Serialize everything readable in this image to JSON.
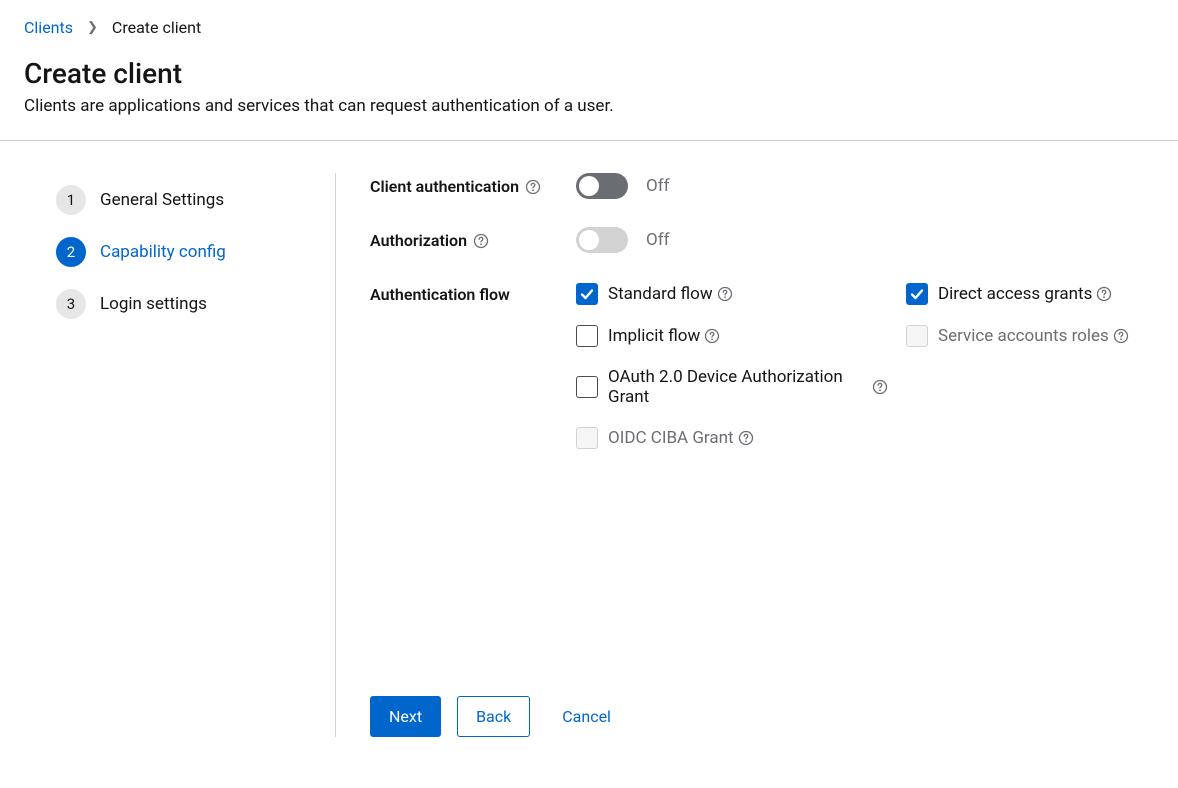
{
  "breadcrumb": {
    "parent": "Clients",
    "current": "Create client"
  },
  "header": {
    "title": "Create client",
    "description": "Clients are applications and services that can request authentication of a user."
  },
  "wizard": {
    "steps": [
      {
        "number": "1",
        "label": "General Settings"
      },
      {
        "number": "2",
        "label": "Capability config"
      },
      {
        "number": "3",
        "label": "Login settings"
      }
    ]
  },
  "form": {
    "client_auth": {
      "label": "Client authentication",
      "state": "Off"
    },
    "authorization": {
      "label": "Authorization",
      "state": "Off"
    },
    "auth_flow": {
      "label": "Authentication flow",
      "items": {
        "standard": "Standard flow",
        "direct": "Direct access grants",
        "implicit": "Implicit flow",
        "service": "Service accounts roles",
        "oauth_device": "OAuth 2.0 Device Authorization Grant",
        "oidc_ciba": "OIDC CIBA Grant"
      }
    }
  },
  "footer": {
    "next": "Next",
    "back": "Back",
    "cancel": "Cancel"
  }
}
